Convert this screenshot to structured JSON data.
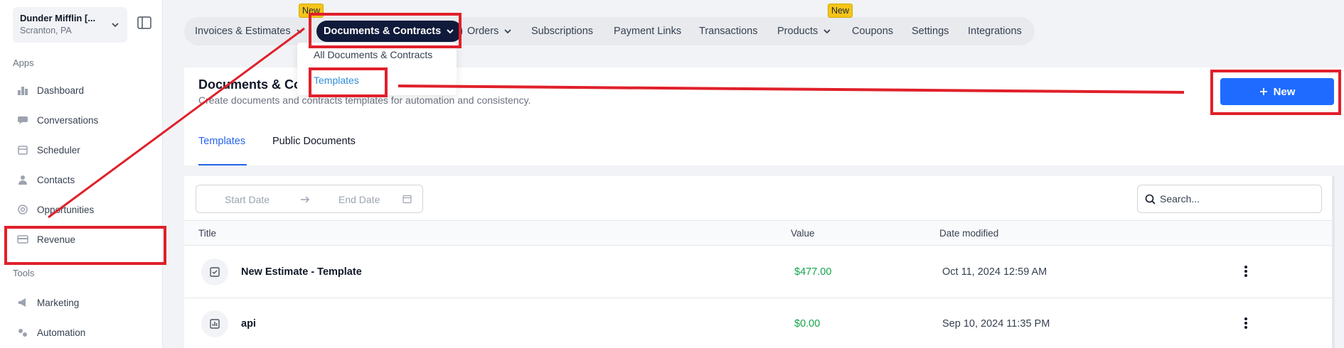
{
  "sidebar": {
    "account": {
      "name": "Dunder Mifflin [...",
      "location": "Scranton, PA"
    },
    "apps_label": "Apps",
    "tools_label": "Tools",
    "apps": [
      {
        "label": "Dashboard",
        "icon": "dashboard-icon"
      },
      {
        "label": "Conversations",
        "icon": "chat-icon"
      },
      {
        "label": "Scheduler",
        "icon": "calendar-icon"
      },
      {
        "label": "Contacts",
        "icon": "person-icon"
      },
      {
        "label": "Opportunities",
        "icon": "target-icon"
      },
      {
        "label": "Revenue",
        "icon": "credit-card-icon"
      }
    ],
    "tools": [
      {
        "label": "Marketing",
        "icon": "megaphone-icon"
      },
      {
        "label": "Automation",
        "icon": "gears-icon"
      }
    ]
  },
  "topnav": {
    "tabs": [
      {
        "label": "Invoices & Estimates"
      },
      {
        "label": "Documents & Contracts"
      },
      {
        "label": "Orders"
      },
      {
        "label": "Subscriptions"
      },
      {
        "label": "Payment Links"
      },
      {
        "label": "Transactions"
      },
      {
        "label": "Products"
      },
      {
        "label": "Coupons"
      },
      {
        "label": "Settings"
      },
      {
        "label": "Integrations"
      }
    ],
    "badge_new": "New"
  },
  "dropdown": {
    "items": [
      {
        "label": "All Documents & Contracts"
      },
      {
        "label": "Templates"
      }
    ]
  },
  "header": {
    "title": "Documents & Co",
    "subtitle": "Create documents and contracts templates for automation and consistency.",
    "new_button": "New",
    "sub_tabs": [
      {
        "label": "Templates"
      },
      {
        "label": "Public Documents"
      }
    ]
  },
  "filters": {
    "start_date_placeholder": "Start Date",
    "end_date_placeholder": "End Date",
    "search_placeholder": "Search..."
  },
  "table": {
    "columns": [
      "Title",
      "Value",
      "Date modified"
    ],
    "rows": [
      {
        "title": "New Estimate - Template",
        "value": "$477.00",
        "date": "Oct 11, 2024 12:59 AM",
        "icon": "estimate-icon"
      },
      {
        "title": "api",
        "value": "$0.00",
        "date": "Sep 10, 2024 11:35 PM",
        "icon": "chart-icon"
      }
    ]
  },
  "colors": {
    "accent": "#1f6bff",
    "active_tab_bg": "#101a3a",
    "badge": "#f5c518",
    "value_green": "#16a34a",
    "annotation_red": "#e0202a"
  }
}
